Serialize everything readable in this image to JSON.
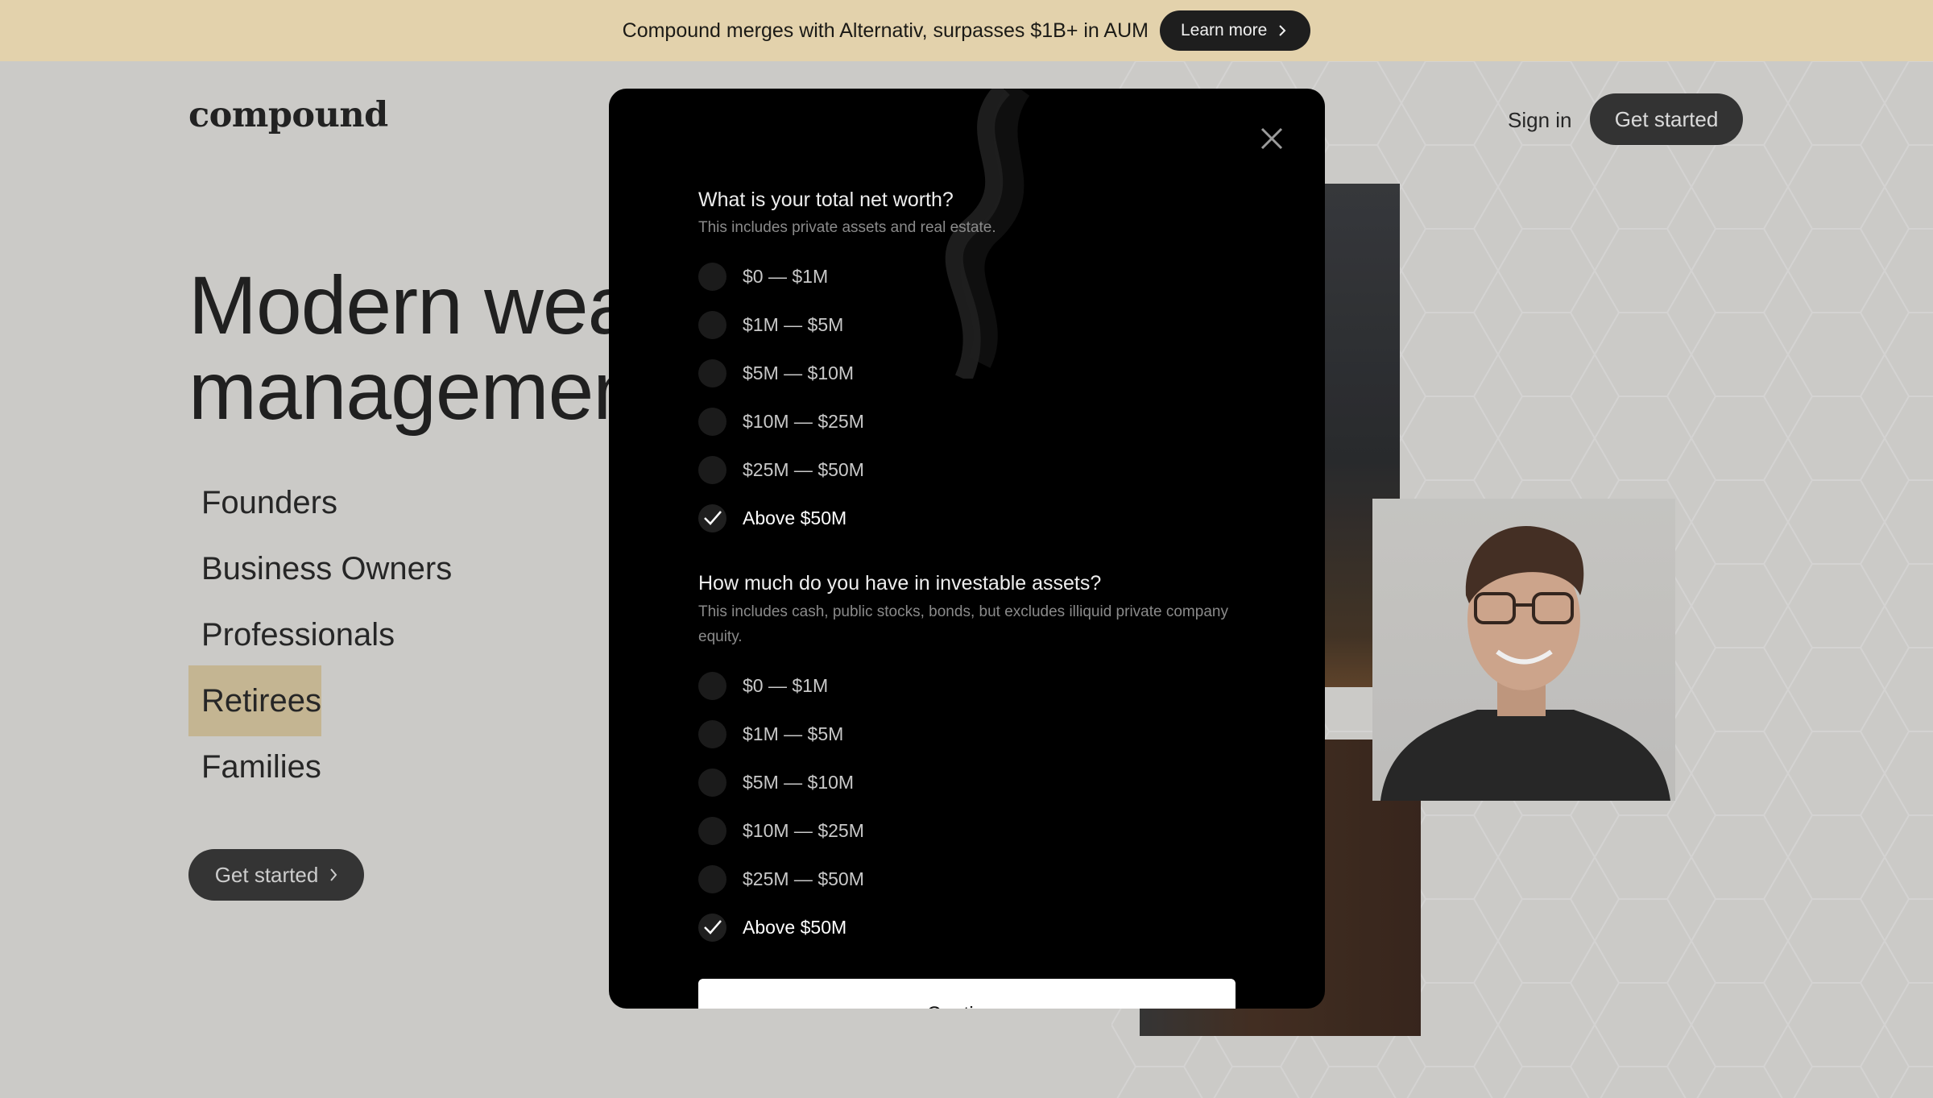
{
  "banner": {
    "text": "Compound merges with Alternativ, surpasses $1B+ in AUM",
    "button_label": "Learn more"
  },
  "header": {
    "logo": "compound",
    "signin_label": "Sign in",
    "get_started_label": "Get started"
  },
  "hero": {
    "title_line1": "Modern wea",
    "title_line2": "managemen",
    "segments": [
      {
        "label": "Founders"
      },
      {
        "label": "Business Owners"
      },
      {
        "label": "Professionals"
      },
      {
        "label": "Retirees"
      },
      {
        "label": "Families"
      }
    ],
    "active_segment": "Retirees",
    "cta_label": "Get started"
  },
  "modal": {
    "q1": {
      "title": "What is your total net worth?",
      "subtitle": "This includes private assets and real estate.",
      "options": [
        "$0 — $1M",
        "$1M — $5M",
        "$5M — $10M",
        "$10M — $25M",
        "$25M — $50M",
        "Above $50M"
      ],
      "selected": "Above $50M"
    },
    "q2": {
      "title": "How much do you have in investable assets?",
      "subtitle": "This includes cash, public stocks, bonds, but excludes illiquid private company equity.",
      "options": [
        "$0 — $1M",
        "$1M — $5M",
        "$5M — $10M",
        "$10M — $25M",
        "$25M — $50M",
        "Above $50M"
      ],
      "selected": "Above $50M"
    },
    "continue_label": "Continue"
  },
  "colors": {
    "banner_bg": "#e3d2ac",
    "active_segment_bg": "#cfbd96",
    "modal_bg": "#000000"
  }
}
